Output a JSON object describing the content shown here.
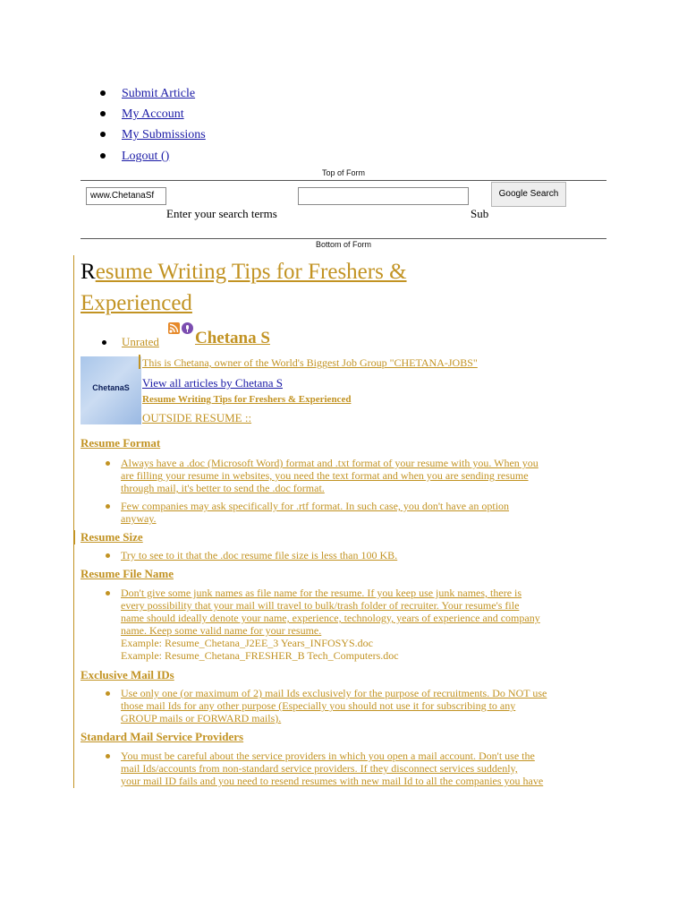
{
  "nav": {
    "items": [
      "Submit Article",
      "My Account",
      "My Submissions",
      "Logout ()"
    ]
  },
  "search_form": {
    "top_label": "Top of Form",
    "bottom_label": "Bottom of Form",
    "domain_value": "www.ChetanaSf",
    "query_value": "",
    "button_label": "Google Search",
    "hint_text": "Enter your search terms",
    "submit_fragment": "Sub"
  },
  "article": {
    "title_first_letter": "R",
    "title_rest_line1": "esume Writing Tips for Freshers & ",
    "title_line2": "Experienced",
    "rating": "Unrated",
    "author": "Chetana S",
    "author_desc": "This is Chetana, owner of the World's Biggest Job Group \"CHETANA-JOBS\" ",
    "view_all_link": "View all articles by Chetana S",
    "avatar_label": "ChetanaS",
    "article_link": "Resume Writing Tips for Freshers & Experienced ",
    "outside_resume": "OUTSIDE RESUME :: "
  },
  "sections": [
    {
      "heading": "Resume Format",
      "bullets": [
        [
          "Always have a .doc (Microsoft Word) format and .txt format of your resume with you. When you",
          "are filling your resume in websites, you need the text format and when you are sending resume",
          "through mail, it's better to send the .doc format."
        ],
        [
          "Few companies may ask specifically for .rtf format. In such case, you don't have an option",
          "anyway."
        ]
      ]
    },
    {
      "heading": "Resume Size ",
      "bullets": [
        [
          "Try to see to it that the .doc resume file size is less than 100 KB."
        ]
      ]
    },
    {
      "heading": "Resume File Name",
      "bullets": [
        [
          "Don't give some junk names as file name for the resume. If you keep use junk names, there is",
          "every possibility that your mail will travel to bulk/trash folder of recruiter. Your resume's file",
          "name should ideally denote your name, experience, technology, years of experience and company",
          "name. Keep some valid name for your resume."
        ]
      ],
      "examples": [
        "Example: Resume_Chetana_J2EE_3 Years_INFOSYS.doc",
        "Example: Resume_Chetana_FRESHER_B Tech_Computers.doc"
      ]
    },
    {
      "heading": "Exclusive Mail IDs",
      "bullets": [
        [
          "Use only one (or maximum of 2) mail Ids exclusively for the purpose of recruitments. Do NOT use",
          "those mail Ids for any other purpose (Especially you should not use it for subscribing to any",
          "GROUP mails or FORWARD mails)."
        ]
      ]
    },
    {
      "heading": "Standard Mail Service Providers",
      "bullets": [
        [
          "You must be careful about the service providers in which you open a mail account. Don't use the",
          "mail Ids/accounts from non-standard service providers. If they disconnect services suddenly,",
          "your mail ID fails and you need to resend resumes with new mail Id to all the companies you have"
        ]
      ]
    }
  ],
  "colors": {
    "accent": "#c29323",
    "link": "#1a1aa6",
    "avatar_bg": "#b6cdee"
  }
}
